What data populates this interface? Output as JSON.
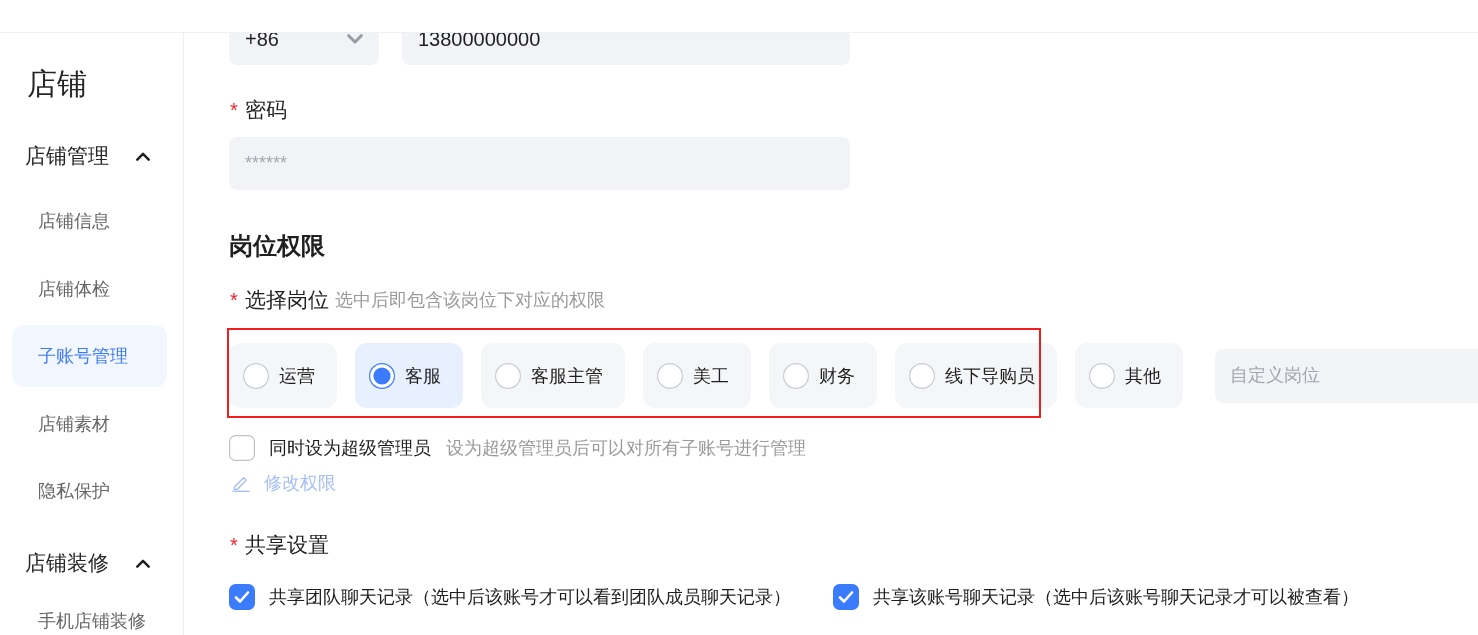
{
  "sidebar": {
    "title": "店铺",
    "groups": [
      {
        "label": "店铺管理",
        "expanded": true,
        "items": [
          {
            "label": "店铺信息",
            "selected": false
          },
          {
            "label": "店铺体检",
            "selected": false
          },
          {
            "label": "子账号管理",
            "selected": true
          },
          {
            "label": "店铺素材",
            "selected": false
          },
          {
            "label": "隐私保护",
            "selected": false
          }
        ]
      },
      {
        "label": "店铺装修",
        "expanded": true,
        "items": [
          {
            "label": "手机店铺装修",
            "selected": false
          }
        ]
      }
    ]
  },
  "phone": {
    "country_code": "+86",
    "number": "13800000000"
  },
  "password": {
    "required_mark": "*",
    "label": "密码",
    "placeholder": "******"
  },
  "section_title": "岗位权限",
  "position": {
    "required_mark": "*",
    "label": "选择岗位",
    "hint": "选中后即包含该岗位下对应的权限",
    "options": [
      {
        "label": "运营",
        "selected": false
      },
      {
        "label": "客服",
        "selected": true
      },
      {
        "label": "客服主管",
        "selected": false
      },
      {
        "label": "美工",
        "selected": false
      },
      {
        "label": "财务",
        "selected": false
      },
      {
        "label": "线下导购员",
        "selected": false
      },
      {
        "label": "其他",
        "selected": false
      }
    ],
    "custom_placeholder": "自定义岗位"
  },
  "super_admin": {
    "label": "同时设为超级管理员",
    "hint": "设为超级管理员后可以对所有子账号进行管理",
    "checked": false
  },
  "edit_link": "修改权限",
  "sharing": {
    "required_mark": "*",
    "label": "共享设置",
    "options": [
      {
        "label": "共享团队聊天记录（选中后该账号才可以看到团队成员聊天记录）",
        "checked": true
      },
      {
        "label": "共享该账号聊天记录（选中后该账号聊天记录才可以被查看）",
        "checked": true
      }
    ]
  },
  "annotation": {
    "kind": "rectangle"
  }
}
